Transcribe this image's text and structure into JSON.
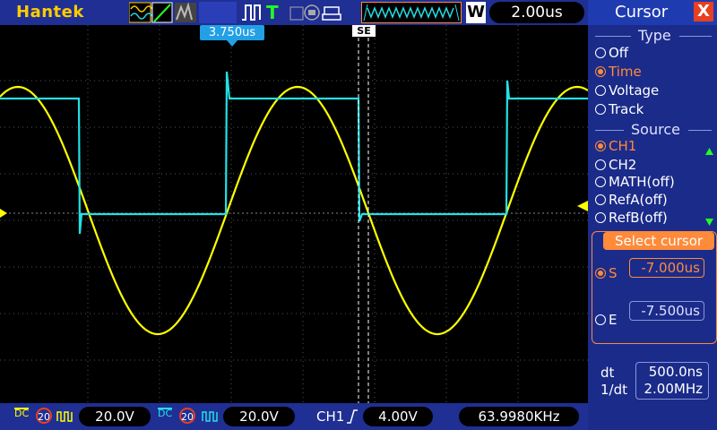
{
  "brand": "Hantek",
  "toolbar": {
    "trigger_mode": "T",
    "run_state_label": "W",
    "timebase": "2.00us"
  },
  "marker": {
    "time_offset": "3.750us",
    "cursor_pair": "SE"
  },
  "bottom": {
    "ch1_coupling": "DC",
    "ch1_bw": "20",
    "ch1_scale": "20.0V",
    "ch2_coupling": "DC",
    "ch2_bw": "20",
    "ch2_scale": "20.0V",
    "trigger_source": "CH1",
    "trigger_level": "4.00V",
    "frequency": "63.9980KHz"
  },
  "panel": {
    "title": "Cursor",
    "close": "X",
    "type_header": "Type",
    "type_options": [
      "Off",
      "Time",
      "Voltage",
      "Track"
    ],
    "type_selected": "Time",
    "source_header": "Source",
    "source_options": [
      "CH1",
      "CH2",
      "MATH(off)",
      "RefA(off)",
      "RefB(off)"
    ],
    "source_selected": "CH1",
    "select_header": "Select cursor",
    "s_label": "S",
    "s_value": "-7.000us",
    "e_label": "E",
    "e_value": "-7.500us",
    "dt_label": "dt",
    "dt_value": "500.0ns",
    "inv_dt_label": "1/dt",
    "inv_dt_value": "2.00MHz"
  },
  "colors": {
    "ch1": "#ffff00",
    "ch2": "#22e0e6",
    "accent": "#ff8a3a",
    "bar": "#1f2f93"
  }
}
